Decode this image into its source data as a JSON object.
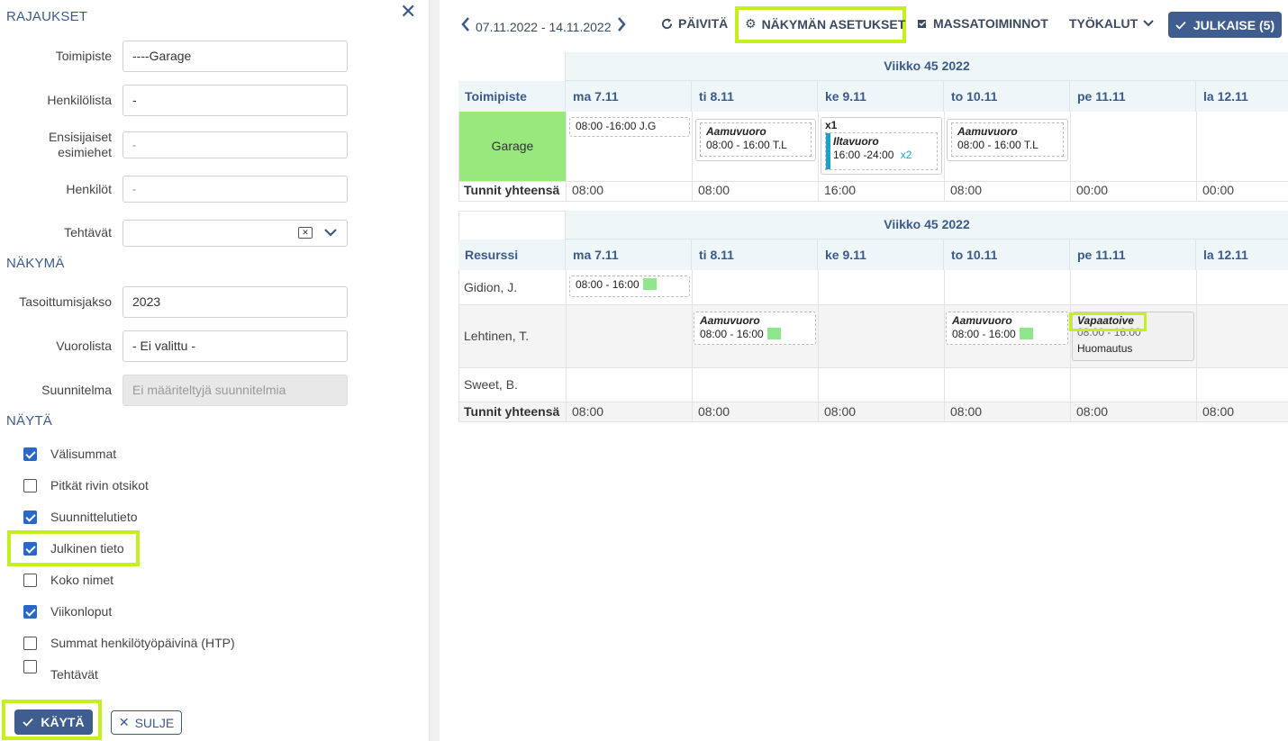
{
  "panel": {
    "section_limits": "RAJAUKSET",
    "section_view": "NÄKYMÄ",
    "section_show": "NÄYTÄ",
    "fields": {
      "office_label": "Toimipiste",
      "office_value": "----Garage",
      "personlist_label": "Henkilölista",
      "personlist_value": "-",
      "supervisors_label_1": "Ensisijaiset",
      "supervisors_label_2": "esimiehet",
      "supervisors_value": "-",
      "persons_label": "Henkilöt",
      "persons_value": "-",
      "tasks_label": "Tehtävät",
      "period_label": "Tasoittumisjakso",
      "period_value": "2023",
      "shiftlist_label": "Vuorolista",
      "shiftlist_value": "- Ei valittu -",
      "plan_label": "Suunnitelma",
      "plan_placeholder": "Ei määriteltyjä suunnitelmia"
    },
    "checkboxes": [
      {
        "label": "Välisummat",
        "checked": true
      },
      {
        "label": "Pitkät rivin otsikot",
        "checked": false
      },
      {
        "label": "Suunnittelutieto",
        "checked": true
      },
      {
        "label": "Julkinen tieto",
        "checked": true
      },
      {
        "label": "Koko nimet",
        "checked": false
      },
      {
        "label": "Viikonloput",
        "checked": true
      },
      {
        "label": "Summat henkilötyöpäivinä (HTP)",
        "checked": false
      },
      {
        "label": "Tehtävät",
        "checked": false
      }
    ],
    "apply_label": "KÄYTÄ",
    "close_label": "SULJE"
  },
  "toolbar": {
    "date_range": "07.11.2022 - 14.11.2022",
    "refresh": "PÄIVITÄ",
    "view_settings": "NÄKYMÄN ASETUKSET",
    "mass_actions": "MASSATOIMINNOT",
    "tools": "TYÖKALUT",
    "publish": "JULKAISE (5)"
  },
  "grid1": {
    "week": "Viikko 45 2022",
    "corner": "Toimipiste",
    "days": [
      "ma 7.11",
      "ti 8.11",
      "ke 9.11",
      "to 10.11",
      "pe 11.11",
      "la 12.11"
    ],
    "row_label": "Garage",
    "shift_mon": "08:00 -16:00 J.G",
    "shift_tue_title": "Aamuvuoro",
    "shift_tue_time": "08:00 - 16:00 T.L",
    "shift_wed_count": "x1",
    "shift_wed_title": "Iltavuoro",
    "shift_wed_time": "16:00 -24:00",
    "shift_wed_mult": "x2",
    "shift_thu_title": "Aamuvuoro",
    "shift_thu_time": "08:00 - 16:00 T.L",
    "total_label": "Tunnit yhteensä",
    "totals": [
      "08:00",
      "08:00",
      "16:00",
      "08:00",
      "00:00",
      "00:00"
    ]
  },
  "grid2": {
    "week": "Viikko 45 2022",
    "corner": "Resurssi",
    "days": [
      "ma 7.11",
      "ti 8.11",
      "ke 9.11",
      "to 10.11",
      "pe 11.11",
      "la 12.11"
    ],
    "rows": [
      "Gidion, J.",
      "Lehtinen, T.",
      "Sweet, B."
    ],
    "g_mon": "08:00 - 16:00",
    "l_tue_title": "Aamuvuoro",
    "l_tue_time": "08:00 - 16:00",
    "l_thu_title": "Aamuvuoro",
    "l_thu_time": "08:00 - 16:00",
    "l_fri_title": "Vapaatoive",
    "l_fri_time": "08:00 - 16:00",
    "l_fri_note": "Huomautus",
    "total_label": "Tunnit yhteensä",
    "totals": [
      "08:00",
      "08:00",
      "08:00",
      "08:00",
      "08:00",
      "08:00"
    ]
  },
  "colors": {
    "highlight": "#c4f01e",
    "accent": "#3f5d8f",
    "garage": "#98e87e",
    "shift_bar": "#1aa3c7"
  }
}
